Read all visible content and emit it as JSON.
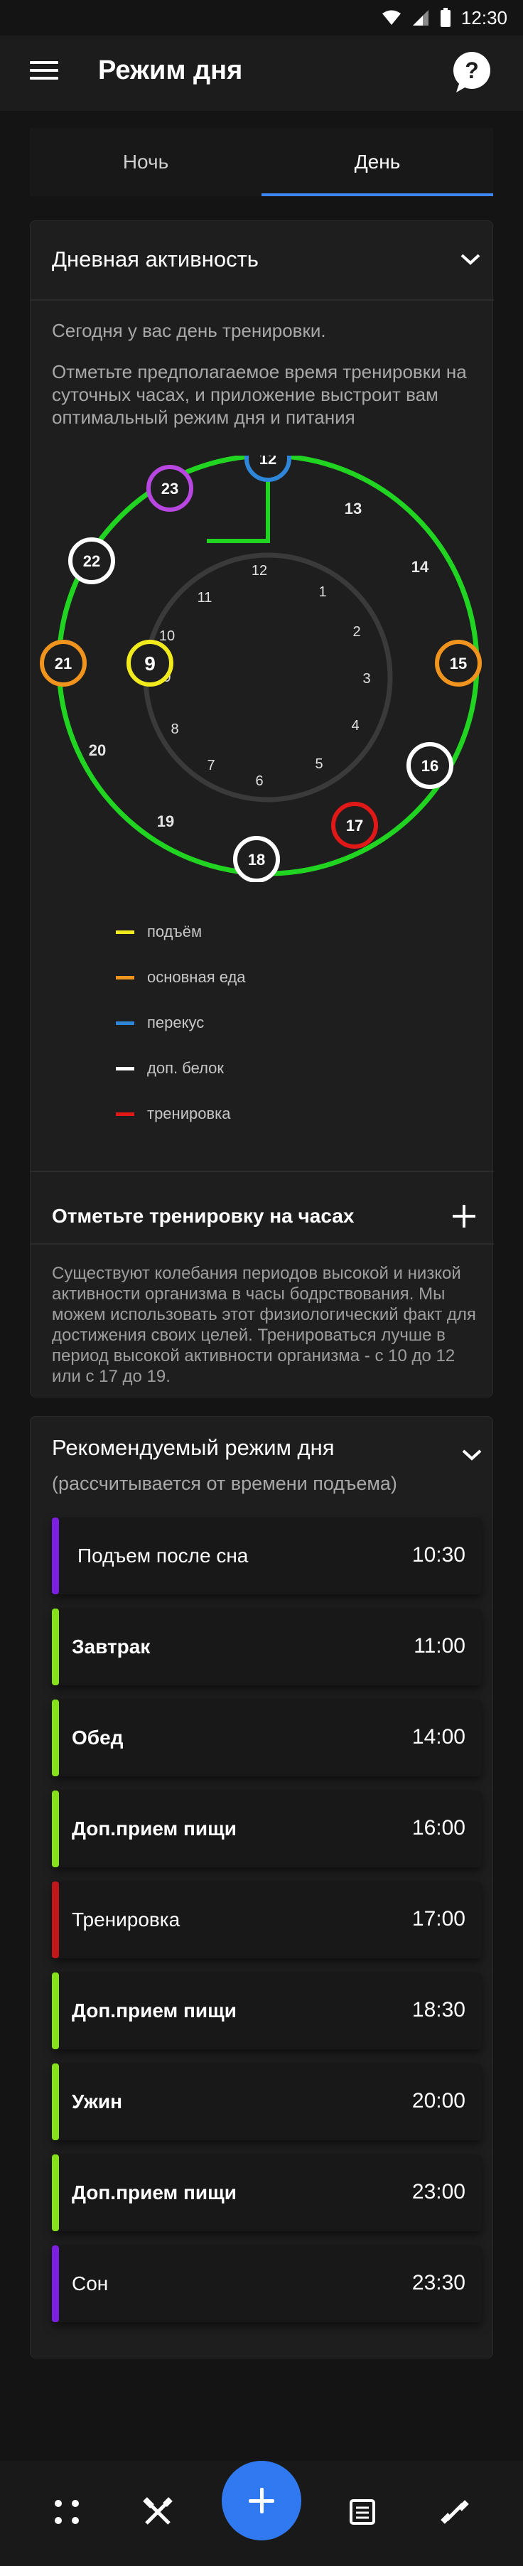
{
  "status_bar": {
    "time": "12:30"
  },
  "app_bar": {
    "title": "Режим дня"
  },
  "tabs": [
    {
      "label": "Ночь",
      "active": false
    },
    {
      "label": "День",
      "active": true
    }
  ],
  "activity_card": {
    "title": "Дневная активность",
    "intro": "Сегодня у вас день тренировки.",
    "hint": "Отметьте предполагаемое время тренировки на суточных часах, и приложение выстроит вам оптимальный режим дня и питания",
    "clock": {
      "inner_numbers": [
        "12",
        "1",
        "2",
        "3",
        "4",
        "5",
        "6",
        "7",
        "8",
        "9",
        "10",
        "11"
      ],
      "outer_plain_hours": [
        "13",
        "14",
        "19",
        "20"
      ],
      "outer_markers": [
        {
          "hour": "12",
          "type": "перекус",
          "color": "#2f86d8"
        },
        {
          "hour": "15",
          "type": "основная еда",
          "color": "#f0941e"
        },
        {
          "hour": "16",
          "type": "доп. белок",
          "color": "#ffffff"
        },
        {
          "hour": "17",
          "type": "тренировка",
          "color": "#e01818"
        },
        {
          "hour": "18",
          "type": "доп. белок",
          "color": "#ffffff"
        },
        {
          "hour": "21",
          "type": "основная еда",
          "color": "#f0941e"
        },
        {
          "hour": "22",
          "type": "доп. белок",
          "color": "#ffffff"
        },
        {
          "hour": "23",
          "type": "сон",
          "color": "#b846e0"
        }
      ],
      "wake_marker": {
        "hour": "9",
        "color": "#f1ea1c"
      },
      "active_arc_color": "#21d421"
    },
    "legend": [
      {
        "label": "подъём",
        "color": "#f1ea1c"
      },
      {
        "label": "основная еда",
        "color": "#f0941e"
      },
      {
        "label": "перекус",
        "color": "#2f86d8"
      },
      {
        "label": "доп. белок",
        "color": "#ffffff"
      },
      {
        "label": "тренировка",
        "color": "#e01818"
      }
    ],
    "add_training_label": "Отметьте тренировку на часах",
    "info": "Существуют колебания периодов высокой и низкой активности организма в часы бодрствования. Мы можем использовать этот физиологический факт для достижения своих целей. Тренироваться лучше в период высокой активности организма - с 10 до 12 или с 17 до 19."
  },
  "schedule_card": {
    "title": "Рекомендуемый режим дня",
    "subtitle": "(рассчитывается от времени подъема)",
    "items": [
      {
        "label": "Подъем после сна",
        "time": "10:30",
        "color": "#7b1fe0",
        "bold": false
      },
      {
        "label": "Завтрак",
        "time": "11:00",
        "color": "#86e01a",
        "bold": true
      },
      {
        "label": "Обед",
        "time": "14:00",
        "color": "#86e01a",
        "bold": true
      },
      {
        "label": "Доп.прием пищи",
        "time": "16:00",
        "color": "#86e01a",
        "bold": true
      },
      {
        "label": "Тренировка",
        "time": "17:00",
        "color": "#c1161c",
        "bold": false
      },
      {
        "label": "Доп.прием пищи",
        "time": "18:30",
        "color": "#86e01a",
        "bold": true
      },
      {
        "label": "Ужин",
        "time": "20:00",
        "color": "#86e01a",
        "bold": true
      },
      {
        "label": "Доп.прием пищи",
        "time": "23:00",
        "color": "#86e01a",
        "bold": true
      },
      {
        "label": "Сон",
        "time": "23:30",
        "color": "#7b1fe0",
        "bold": false
      }
    ]
  },
  "bottom_nav": {
    "items": [
      "apps-grid-icon",
      "fork-knife-icon",
      "add-icon",
      "list-icon",
      "dumbbell-icon"
    ],
    "fab_color": "#3079f0"
  }
}
